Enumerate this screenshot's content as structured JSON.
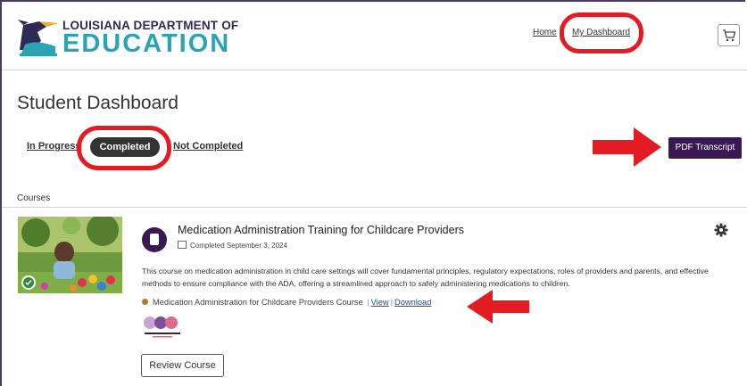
{
  "header": {
    "logo_top": "LOUISIANA DEPARTMENT OF",
    "logo_bottom": "EDUCATION",
    "nav": {
      "home": "Home",
      "dashboard": "My Dashboard"
    },
    "cart_icon": "cart-icon"
  },
  "page": {
    "title": "Student Dashboard",
    "tabs": [
      {
        "label": "In Progress",
        "active": false
      },
      {
        "label": "Completed",
        "active": true
      },
      {
        "label": "Not Completed",
        "active": false
      }
    ],
    "pdf_button": "PDF Transcript",
    "courses_label": "Courses"
  },
  "course": {
    "title": "Medication Administration Training for Childcare Providers",
    "completed": "Completed September 3, 2024",
    "description": "This course on medication administration in child care settings will cover fundamental principles, regulatory expectations, roles of providers and parents, and effective methods to ensure compliance with the ADA, offering a streamlined approach to safely administering medications to children.",
    "resource_name": "Medication Administration for Childcare Providers Course",
    "view_label": "View",
    "download_label": "Download",
    "review_button": "Review Course"
  },
  "colors": {
    "brand_purple": "#3a1952",
    "brand_teal": "#2aa3b5",
    "annotation_red": "#e31b23"
  }
}
